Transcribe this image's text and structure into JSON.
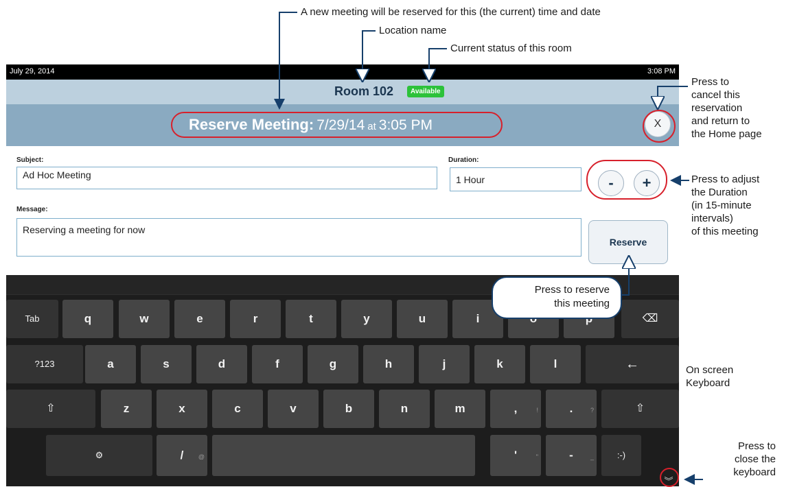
{
  "status_bar": {
    "date": "July 29, 2014",
    "time": "3:08 PM"
  },
  "room": {
    "name": "Room 102",
    "status": "Available"
  },
  "header": {
    "label": "Reserve Meeting:",
    "date": "7/29/14",
    "at": "at",
    "time": "3:05 PM",
    "close": "X"
  },
  "form": {
    "subject_label": "Subject:",
    "subject_value": "Ad Hoc Meeting",
    "duration_label": "Duration:",
    "duration_value": "1 Hour",
    "minus": "-",
    "plus": "+",
    "message_label": "Message:",
    "message_value": "Reserving a meeting for now",
    "reserve_button": "Reserve"
  },
  "keyboard": {
    "row1": [
      "Tab",
      "q",
      "w",
      "e",
      "r",
      "t",
      "y",
      "u",
      "i",
      "o",
      "p",
      "⌫"
    ],
    "row2": [
      "?123",
      "a",
      "s",
      "d",
      "f",
      "g",
      "h",
      "j",
      "k",
      "l",
      "←"
    ],
    "row3": [
      "⇧",
      "z",
      "x",
      "c",
      "v",
      "b",
      "n",
      "m",
      ",",
      ".",
      "⇧"
    ],
    "row4": [
      "⚙",
      "/",
      "",
      "'",
      "-",
      ":-)"
    ],
    "supers": {
      "comma": "!",
      "period": "?",
      "slash": "@",
      "apos": "\"",
      "dash": "_"
    }
  },
  "annotations": {
    "new_meeting": "A new meeting will be reserved for this (the current) time and date",
    "location_name": "Location name",
    "current_status": "Current status of this room",
    "cancel": [
      "Press to",
      "cancel this",
      "reservation",
      "and return to",
      "the Home page"
    ],
    "adjust": [
      "Press to adjust",
      "the Duration",
      "(in 15-minute",
      "intervals)",
      "of this meeting"
    ],
    "reserve": [
      "Press to reserve",
      "this meeting"
    ],
    "keyboard": [
      "On screen",
      "Keyboard"
    ],
    "close_keyboard": [
      "Press to",
      "close the",
      "keyboard"
    ]
  },
  "colors": {
    "callout_line": "#163f6b",
    "highlight_ring": "#d7202b",
    "badge": "#2cc23a",
    "header": "#8aaac1",
    "room_bar": "#bcd0de"
  }
}
